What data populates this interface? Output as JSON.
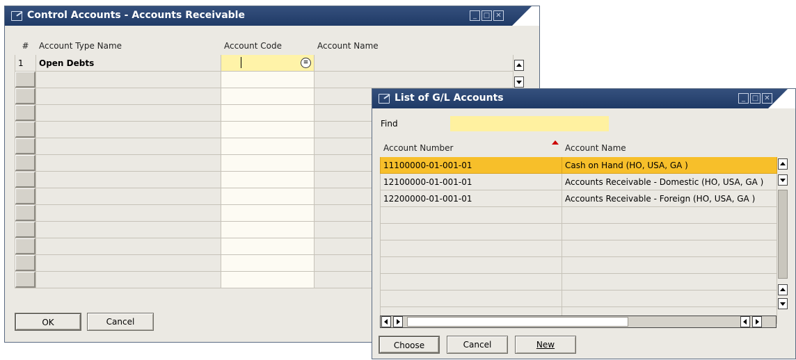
{
  "control_accounts": {
    "title": "Control Accounts - Accounts Receivable",
    "columns": [
      "#",
      "Account Type Name",
      "Account Code",
      "Account Name"
    ],
    "rows": [
      {
        "num": "1",
        "type_name": "Open Debts",
        "code": "",
        "name": ""
      }
    ],
    "ok_label": "OK",
    "cancel_label": "Cancel"
  },
  "gl_list": {
    "title": "List of G/L Accounts",
    "find_label": "Find",
    "find_value": "",
    "columns": [
      "Account Number",
      "Account Name"
    ],
    "rows": [
      {
        "number": "11100000-01-001-01",
        "name": "Cash on Hand (HO, USA, GA )",
        "selected": true
      },
      {
        "number": "12100000-01-001-01",
        "name": "Accounts Receivable - Domestic (HO, USA, GA )"
      },
      {
        "number": "12200000-01-001-01",
        "name": "Accounts Receivable - Foreign (HO, USA, GA )"
      }
    ],
    "choose_label": "Choose",
    "cancel_label": "Cancel",
    "new_label": "New"
  },
  "colors": {
    "title_bar": "#1f3a66",
    "selected_row": "#f7bf2a",
    "find_field": "#fff1a0",
    "sort_indicator": "#cc0000"
  },
  "icons": [
    "window-minimize-icon",
    "window-maximize-icon",
    "window-close-icon",
    "form-icon",
    "choose-from-list-icon",
    "sort-ascending-icon"
  ]
}
